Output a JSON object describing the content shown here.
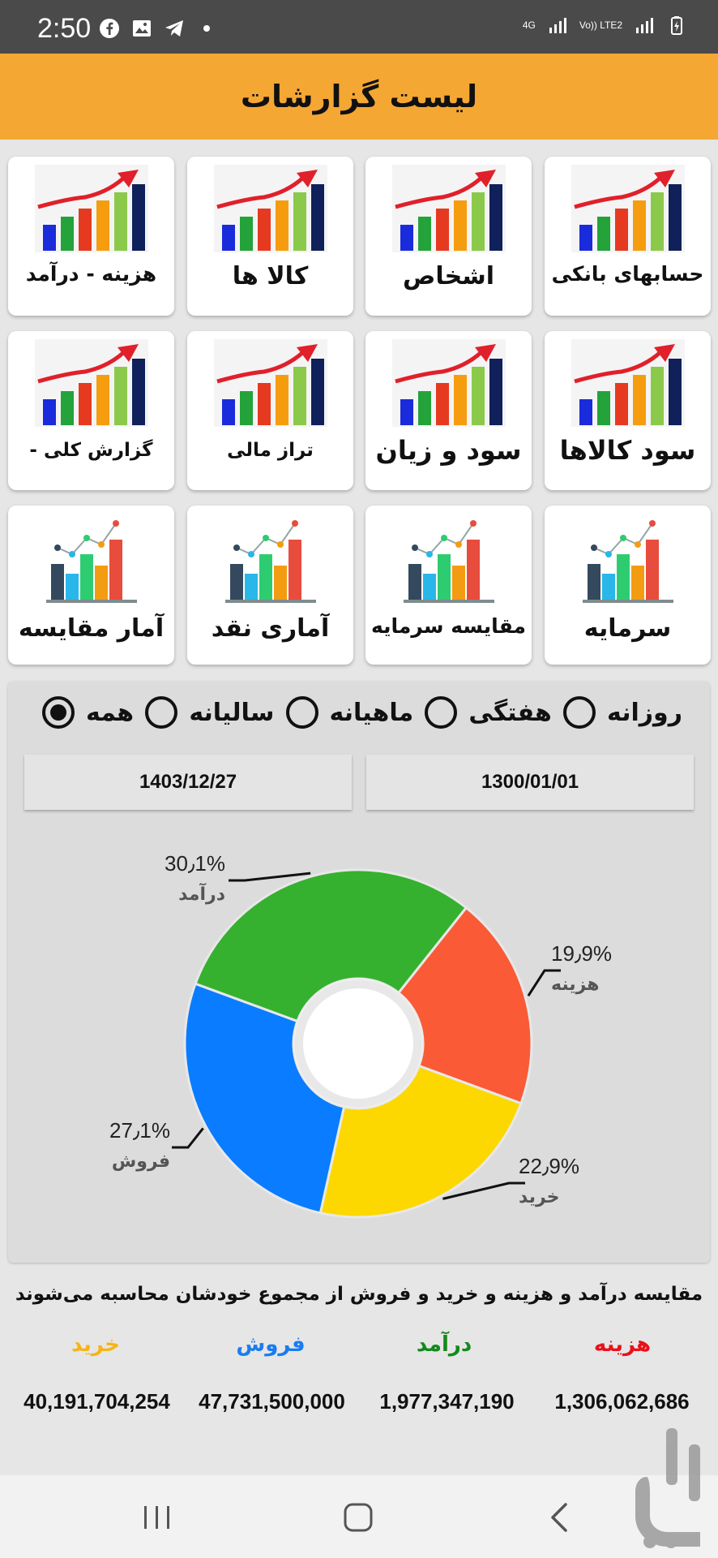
{
  "status_bar": {
    "time": "2:50",
    "network_1": "4G",
    "network_2": "Vo)) LTE2"
  },
  "app_bar": {
    "title": "لیست گزارشات"
  },
  "report_grid": [
    {
      "label": "حسابهای بانکی",
      "icon": "rising-bar-chart-icon"
    },
    {
      "label": "اشخاص",
      "icon": "rising-bar-chart-icon"
    },
    {
      "label": "کالا ها",
      "icon": "rising-bar-chart-icon"
    },
    {
      "label": "هزینه - درآمد",
      "icon": "rising-bar-chart-icon"
    },
    {
      "label": "سود کالاها",
      "icon": "rising-bar-chart-icon"
    },
    {
      "label": "سود و زیان",
      "icon": "rising-bar-chart-icon"
    },
    {
      "label": "تراز مالی",
      "icon": "rising-bar-chart-icon"
    },
    {
      "label": "گزارش کلی -",
      "icon": "rising-bar-chart-icon"
    },
    {
      "label": "سرمایه",
      "icon": "trend-bar-chart-icon"
    },
    {
      "label": "مقایسه سرمایه",
      "icon": "trend-bar-chart-icon"
    },
    {
      "label": "آماری نقد",
      "icon": "trend-bar-chart-icon"
    },
    {
      "label": "آمار مقایسه",
      "icon": "trend-bar-chart-icon"
    }
  ],
  "period_filter": {
    "options": [
      {
        "label": "روزانه",
        "selected": false
      },
      {
        "label": "هفتگی",
        "selected": false
      },
      {
        "label": "ماهیانه",
        "selected": false
      },
      {
        "label": "سالیانه",
        "selected": false
      },
      {
        "label": "همه",
        "selected": true
      }
    ]
  },
  "date_range": {
    "from": "1300/01/01",
    "to": "1403/12/27"
  },
  "chart_data": {
    "type": "pie",
    "donut": true,
    "slices": [
      {
        "label": "هزینه",
        "value": 19.9,
        "display": "19٫9%",
        "color": "#fa5a36"
      },
      {
        "label": "خرید",
        "value": 22.9,
        "display": "22٫9%",
        "color": "#fcd800"
      },
      {
        "label": "فروش",
        "value": 27.1,
        "display": "27٫1%",
        "color": "#0a7cff"
      },
      {
        "label": "درآمد",
        "value": 30.1,
        "display": "30٫1%",
        "color": "#35b12f"
      }
    ]
  },
  "summary": {
    "note": "مقایسه درآمد و هزینه و خرید و فروش از مجموع خودشان محاسبه می‌شوند",
    "items": [
      {
        "label": "هزینه",
        "value": "1,306,062,686",
        "color": "#e8111a"
      },
      {
        "label": "درآمد",
        "value": "1,977,347,190",
        "color": "#138a1b"
      },
      {
        "label": "فروش",
        "value": "47,731,500,000",
        "color": "#1a7cf0"
      },
      {
        "label": "خرید",
        "value": "40,191,704,254",
        "color": "#f6b416"
      }
    ]
  },
  "nav_bar": {
    "buttons": [
      "recents",
      "home",
      "back"
    ]
  }
}
